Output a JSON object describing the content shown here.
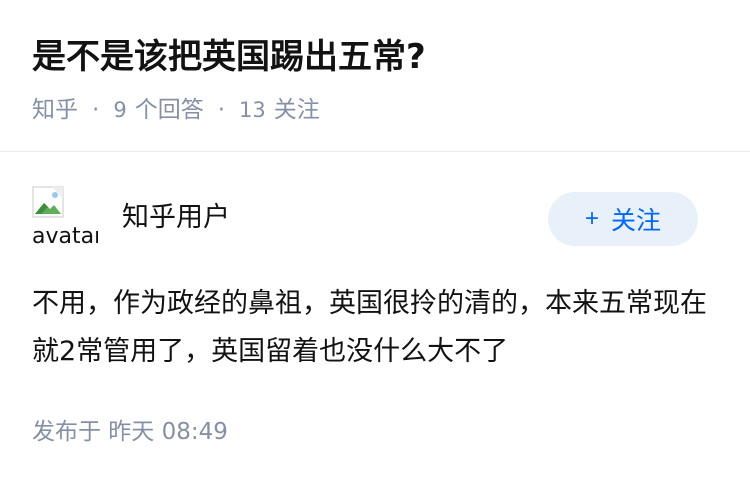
{
  "question": {
    "title": "是不是该把英国踢出五常?",
    "source": "知乎",
    "separator": "·",
    "answer_count": "9",
    "answer_label": "个回答",
    "follower_count": "13",
    "follower_label": "关注"
  },
  "answer": {
    "avatar_alt": "avatar",
    "author": "知乎用户",
    "follow_plus": "+",
    "follow_label": "关注",
    "content": "不用，作为政经的鼻祖，英国很拎的清的，本来五常现在就2常管用了，英国留着也没什么大不了",
    "published": "发布于  昨天 08:49"
  },
  "colors": {
    "accent": "#0066ff",
    "follow_bg": "#e8f0f9",
    "meta_text": "#8590a6",
    "divider": "#ebebeb"
  }
}
